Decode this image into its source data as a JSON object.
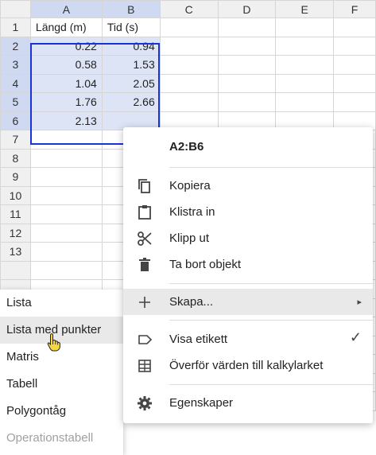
{
  "grid": {
    "columns": [
      "A",
      "B",
      "C",
      "D",
      "E",
      "F"
    ],
    "rows": [
      {
        "num": "1",
        "a": "Längd (m)",
        "b": "Tid (s)"
      },
      {
        "num": "2",
        "a": "0.22",
        "b": "0.94"
      },
      {
        "num": "3",
        "a": "0.58",
        "b": "1.53"
      },
      {
        "num": "4",
        "a": "1.04",
        "b": "2.05"
      },
      {
        "num": "5",
        "a": "1.76",
        "b": "2.66"
      },
      {
        "num": "6",
        "a": "2.13",
        "b": ""
      },
      {
        "num": "7",
        "a": "",
        "b": ""
      },
      {
        "num": "8",
        "a": "",
        "b": ""
      },
      {
        "num": "9",
        "a": "",
        "b": ""
      },
      {
        "num": "10",
        "a": "",
        "b": ""
      },
      {
        "num": "11",
        "a": "",
        "b": ""
      },
      {
        "num": "12",
        "a": "",
        "b": ""
      },
      {
        "num": "13",
        "a": "",
        "b": ""
      }
    ]
  },
  "context_menu": {
    "title": "A2:B6",
    "items": {
      "copy": "Kopiera",
      "paste": "Klistra in",
      "cut": "Klipp ut",
      "delete": "Ta bort objekt",
      "create": "Skapa...",
      "show_label": "Visa etikett",
      "transfer": "Överför värden till kalkylarket",
      "properties": "Egenskaper"
    },
    "create_arrow": "▸",
    "check": "✓"
  },
  "submenu": {
    "items": [
      "Lista",
      "Lista med punkter",
      "Matris",
      "Tabell",
      "Polygontåg",
      "Operationstabell"
    ]
  },
  "colors": {
    "selection_border": "#1a33d6",
    "selection_fill": "#dde4f5",
    "header_highlight": "#cfd9f2"
  }
}
